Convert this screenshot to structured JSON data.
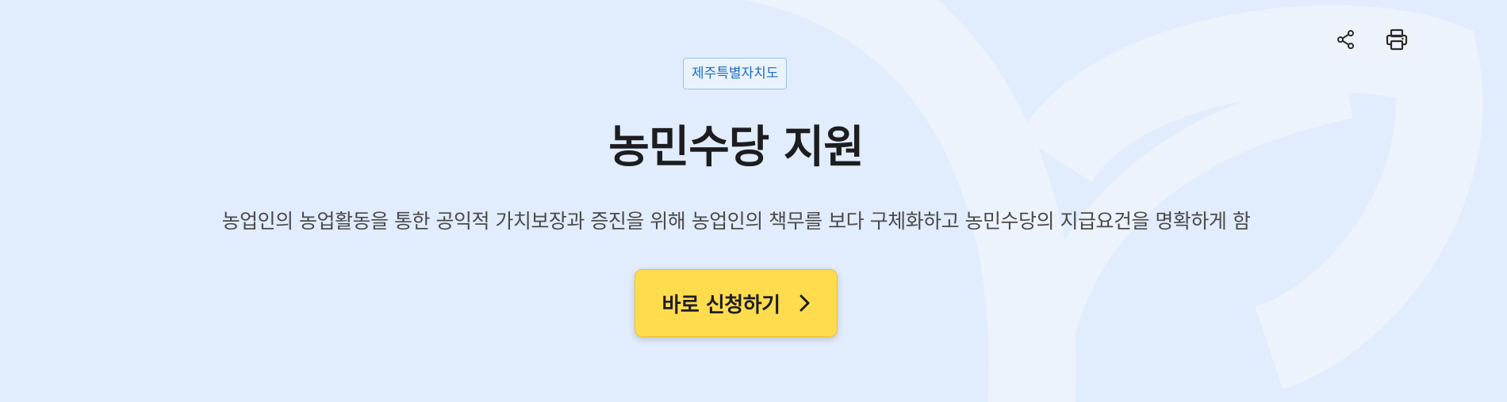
{
  "region_badge": "제주특별자치도",
  "title": "농민수당 지원",
  "description": "농업인의 농업활동을 통한 공익적 가치보장과 증진을 위해 농업인의 책무를 보다 구체화하고 농민수당의 지급요건을 명확하게 함",
  "apply_button": {
    "label": "바로 신청하기",
    "icon": "chevron-right-icon"
  },
  "toolbar": {
    "share_icon": "share-icon",
    "print_icon": "printer-icon"
  },
  "colors": {
    "background": "#e1ecfd",
    "badge_text": "#1a6ec8",
    "apply_button": "#ffdc4e",
    "title_text": "#1d1d1f"
  }
}
